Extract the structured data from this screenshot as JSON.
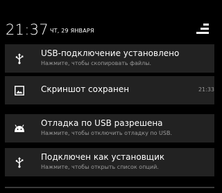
{
  "status_bar": {
    "time": "21:37",
    "date": "ЧТ, 29 ЯНВАРЯ"
  },
  "notifications": [
    {
      "icon": "usb-icon",
      "title": "USB-подключение установлено",
      "subtitle": "Нажмите, чтобы скопировать файлы."
    },
    {
      "icon": "image-icon",
      "title": "Скриншот сохранен",
      "time": "21:33"
    },
    {
      "icon": "android-debug-icon",
      "title": "Отладка по USB разрешена",
      "subtitle": "Нажмите, чтобы отключить отладку по USB."
    },
    {
      "icon": "usb-icon",
      "title": "Подключен как установщик",
      "subtitle": "Нажмите, чтобы открыть список опций."
    }
  ],
  "colors": {
    "background": "#000000",
    "card": "#222222",
    "primary_text": "#ffffff",
    "secondary_text": "#9a9a9a"
  }
}
